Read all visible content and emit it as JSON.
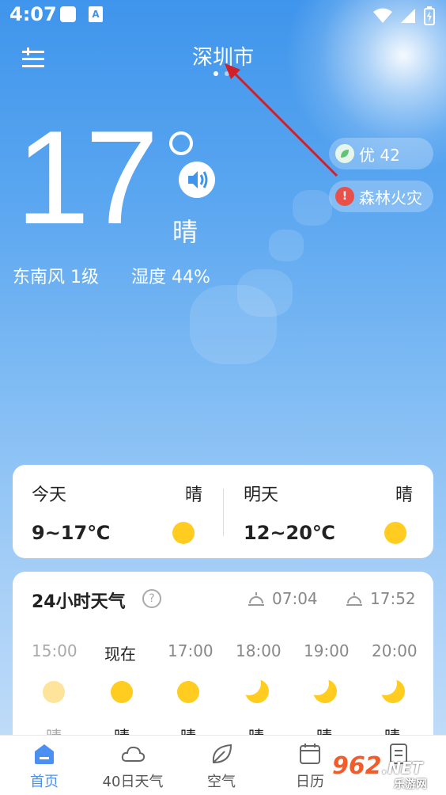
{
  "status": {
    "time": "4:07",
    "a_label": "A"
  },
  "header": {
    "city": "深圳市"
  },
  "current": {
    "temp": "17",
    "condition": "晴",
    "wind": "东南风 1级",
    "humidity": "湿度 44%"
  },
  "badges": {
    "aqi": "优 42",
    "alert": "森林火灾",
    "alert_mark": "!"
  },
  "daily": {
    "today": {
      "label": "今天",
      "cond": "晴",
      "range": "9~17℃"
    },
    "tomorrow": {
      "label": "明天",
      "cond": "晴",
      "range": "12~20℃"
    }
  },
  "hourly": {
    "title": "24小时天气",
    "help": "?",
    "sunrise": "07:04",
    "sunset": "17:52",
    "hours": [
      {
        "time": "15:00",
        "icon": "sun-faded",
        "cond": "晴"
      },
      {
        "time": "现在",
        "icon": "sun",
        "cond": "晴"
      },
      {
        "time": "17:00",
        "icon": "sun",
        "cond": "晴"
      },
      {
        "time": "18:00",
        "icon": "moon",
        "cond": "晴"
      },
      {
        "time": "19:00",
        "icon": "moon",
        "cond": "晴"
      },
      {
        "time": "20:00",
        "icon": "moon",
        "cond": "晴"
      }
    ]
  },
  "tabs": [
    {
      "label": "首页",
      "icon": "home-icon",
      "active": true
    },
    {
      "label": "40日天气",
      "icon": "cloud-icon"
    },
    {
      "label": "空气",
      "icon": "leaf-icon"
    },
    {
      "label": "日历",
      "icon": "calendar-icon"
    },
    {
      "label": "",
      "icon": "document-icon"
    }
  ],
  "watermark": {
    "main": "962",
    "suffix": ".NET",
    "sub": "乐游网"
  },
  "colors": {
    "accent": "#4b8ff0",
    "sun": "#ffcc1f",
    "alert": "#e8504a",
    "aqi": "#5fc37a"
  }
}
